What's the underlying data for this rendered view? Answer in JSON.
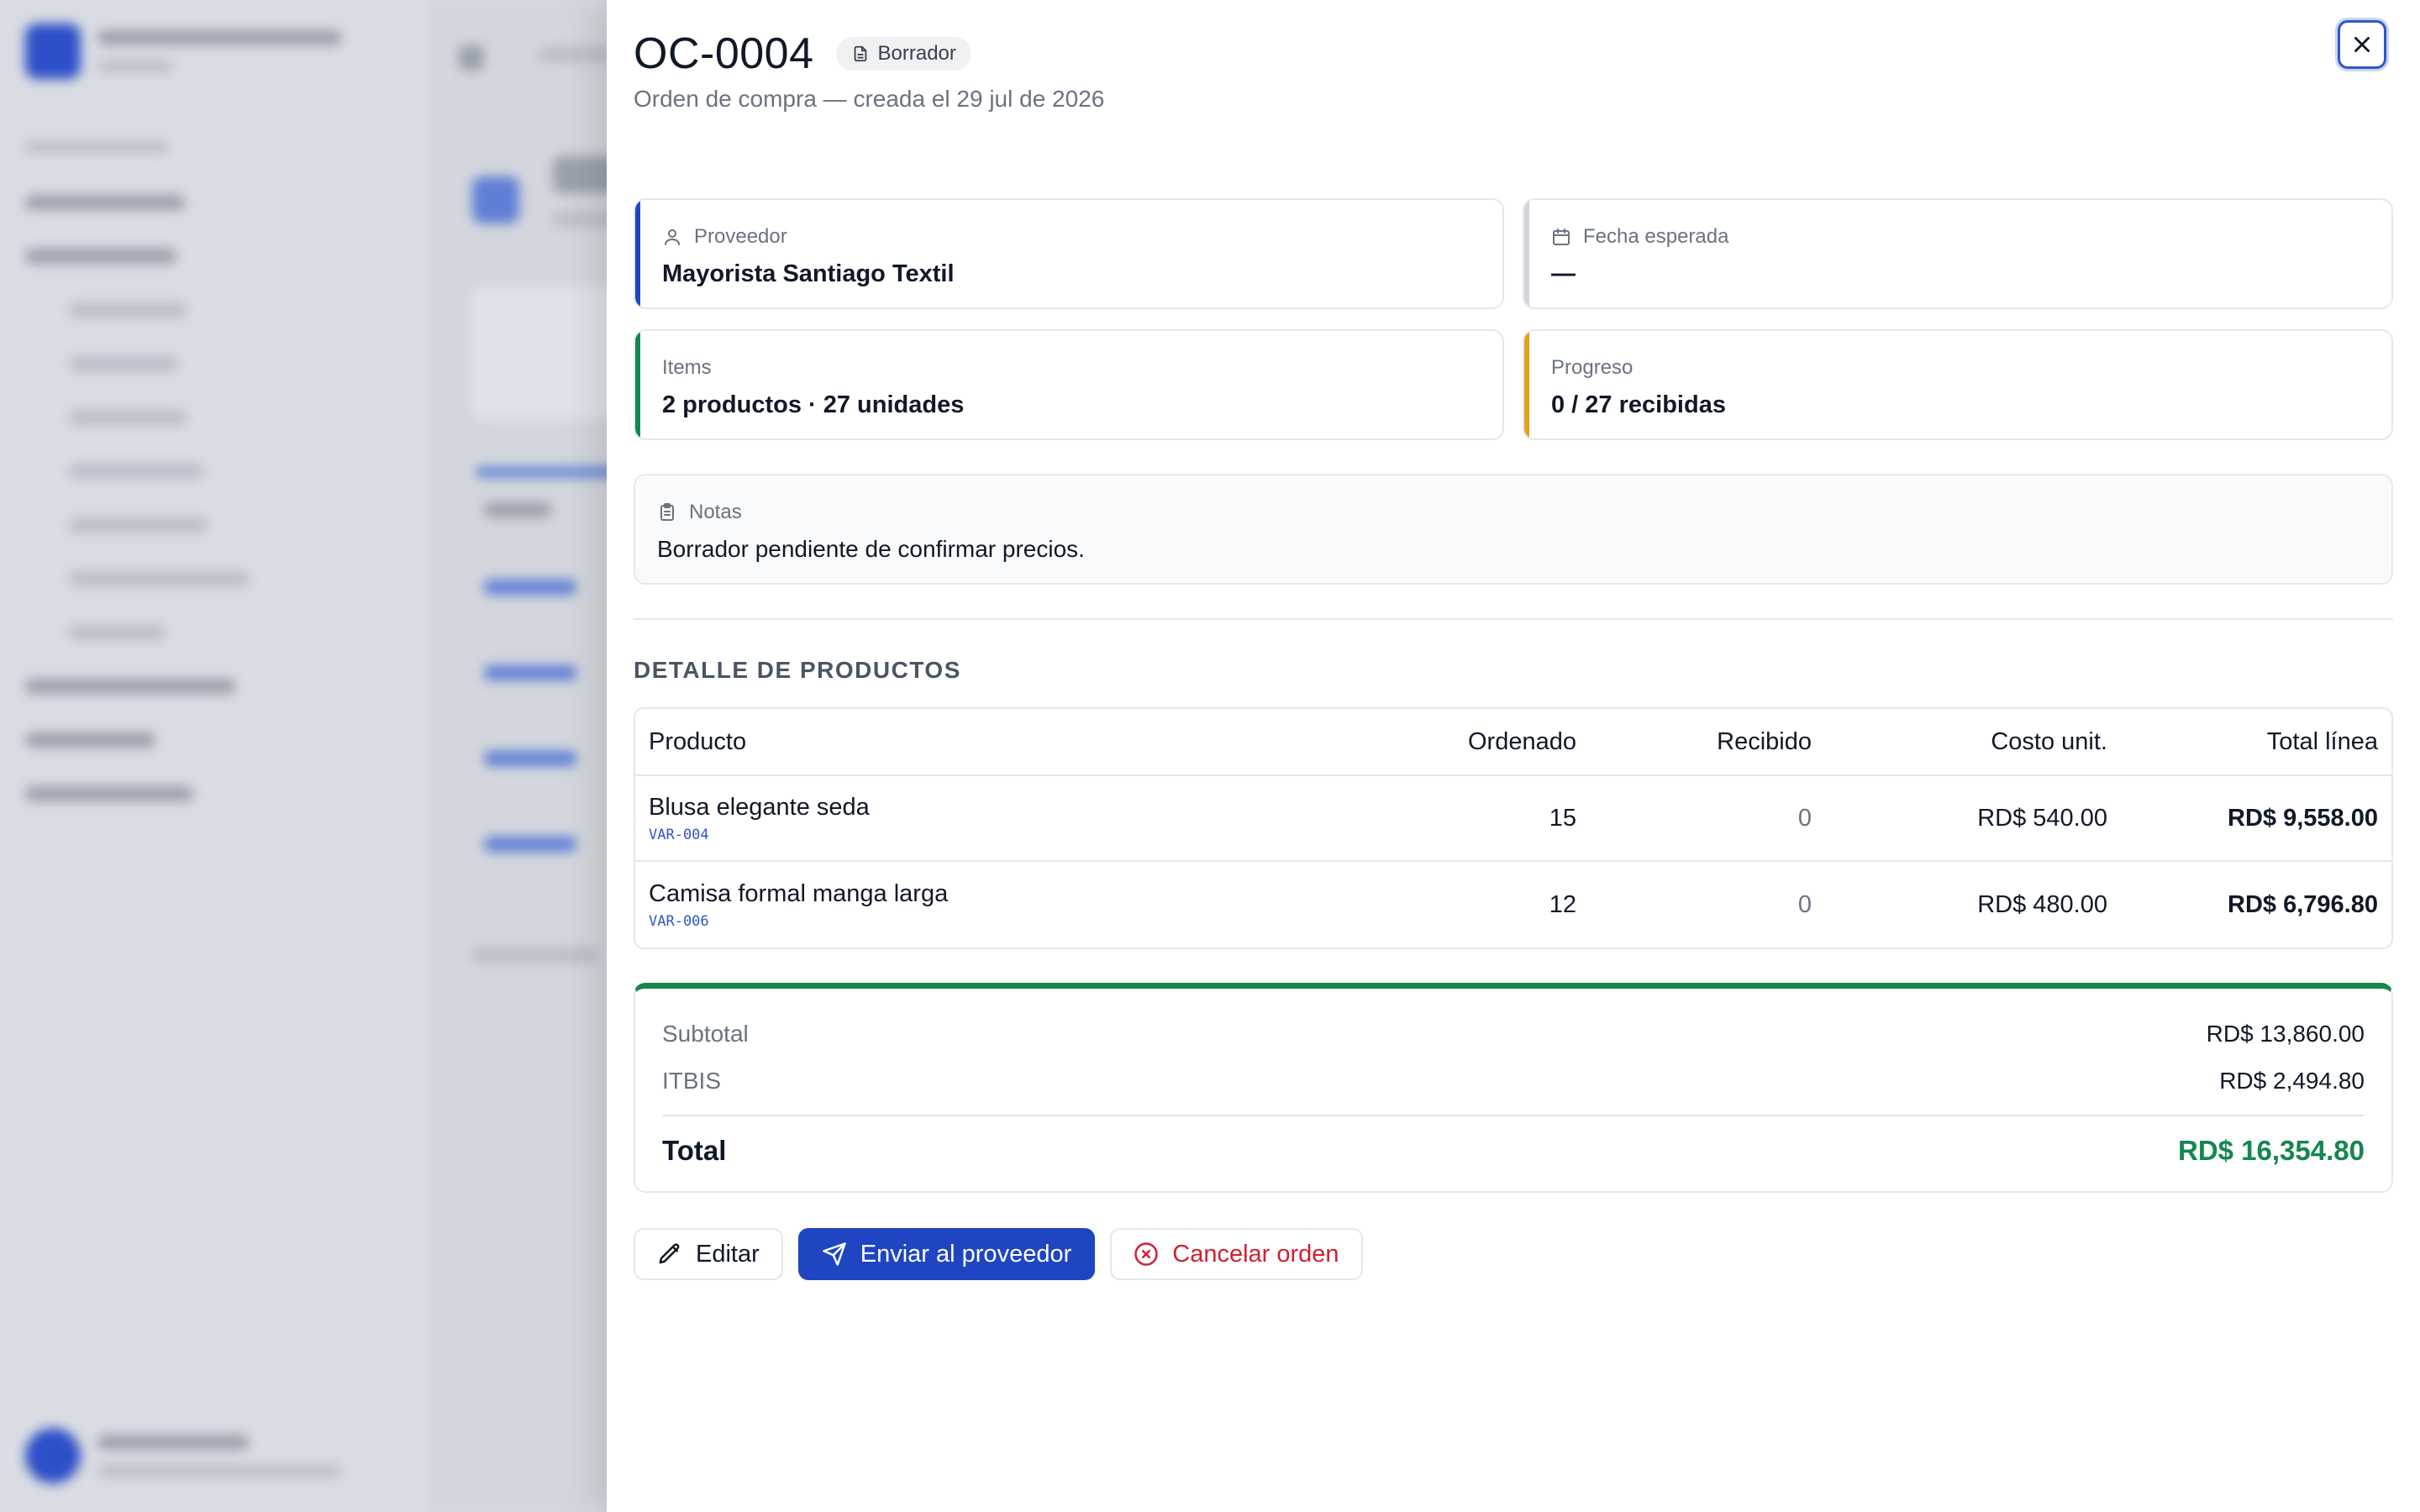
{
  "order": {
    "title": "OC-0004",
    "status": "Borrador",
    "subtitle": "Orden de compra — creada el 29 jul de 2026"
  },
  "info": {
    "supplier_label": "Proveedor",
    "supplier_value": "Mayorista Santiago Textil",
    "expected_label": "Fecha esperada",
    "expected_value": "—",
    "items_label": "Items",
    "items_value": "2 productos · 27 unidades",
    "progress_label": "Progreso",
    "progress_value": "0 / 27 recibidas"
  },
  "notes": {
    "label": "Notas",
    "text": "Borrador pendiente de confirmar precios."
  },
  "details": {
    "section_title": "DETALLE DE PRODUCTOS",
    "headers": {
      "product": "Producto",
      "ordered": "Ordenado",
      "received": "Recibido",
      "unit_cost": "Costo unit.",
      "line_total": "Total línea"
    },
    "rows": [
      {
        "name": "Blusa elegante seda",
        "sku": "VAR-004",
        "ordered": "15",
        "received": "0",
        "unit_cost": "RD$ 540.00",
        "line_total": "RD$ 9,558.00"
      },
      {
        "name": "Camisa formal manga larga",
        "sku": "VAR-006",
        "ordered": "12",
        "received": "0",
        "unit_cost": "RD$ 480.00",
        "line_total": "RD$ 6,796.80"
      }
    ]
  },
  "totals": {
    "subtotal_label": "Subtotal",
    "subtotal_value": "RD$ 13,860.00",
    "tax_label": "ITBIS",
    "tax_value": "RD$ 2,494.80",
    "total_label": "Total",
    "total_value": "RD$ 16,354.80"
  },
  "actions": {
    "edit": "Editar",
    "send": "Enviar al proveedor",
    "cancel": "Cancelar orden"
  },
  "colors": {
    "primary": "#1f45c2",
    "accent_blue": "#1f45c2",
    "accent_green": "#14874f",
    "accent_amber": "#e0a21b",
    "accent_gray": "#d1d5db",
    "danger": "#d11f2f"
  },
  "icons": {
    "close": "close-icon",
    "status": "document-icon",
    "supplier": "user-icon",
    "expected": "calendar-icon",
    "notes": "clipboard-icon",
    "edit": "pencil-icon",
    "send": "send-icon",
    "cancel": "x-circle-icon"
  }
}
